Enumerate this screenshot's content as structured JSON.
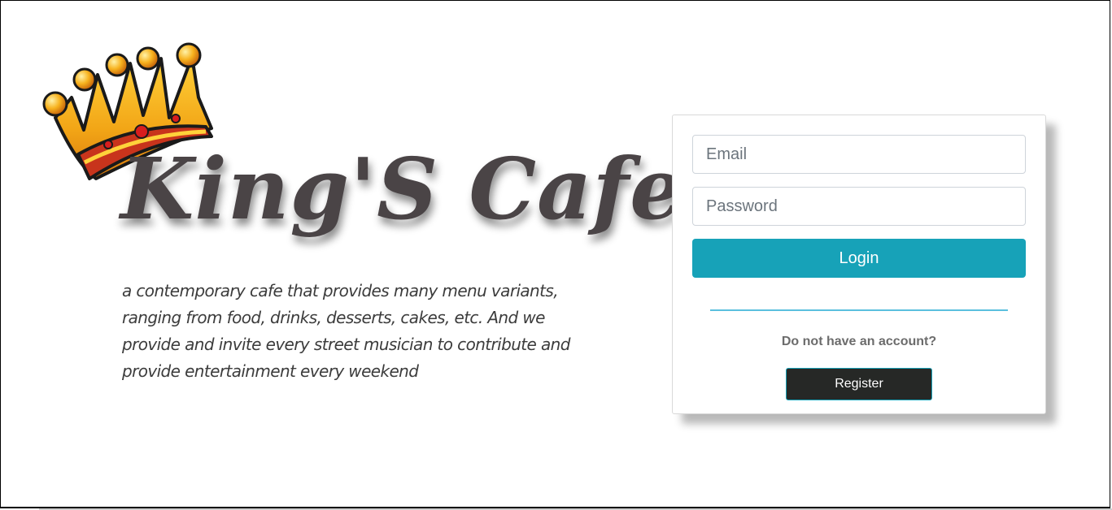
{
  "brand": {
    "icon": "crown-icon",
    "title": "King'S Cafe",
    "description": "a contemporary cafe that provides many menu variants, ranging from food, drinks, desserts, cakes, etc. And we provide and invite every street musician to contribute and provide entertainment every weekend"
  },
  "login": {
    "email_placeholder": "Email",
    "password_placeholder": "Password",
    "login_label": "Login",
    "signup_prompt": "Do not have an account?",
    "register_label": "Register"
  },
  "colors": {
    "login_button": "#17a2b8",
    "register_button": "#262826",
    "divider": "#5bc0de",
    "title_text": "#4a4446"
  }
}
